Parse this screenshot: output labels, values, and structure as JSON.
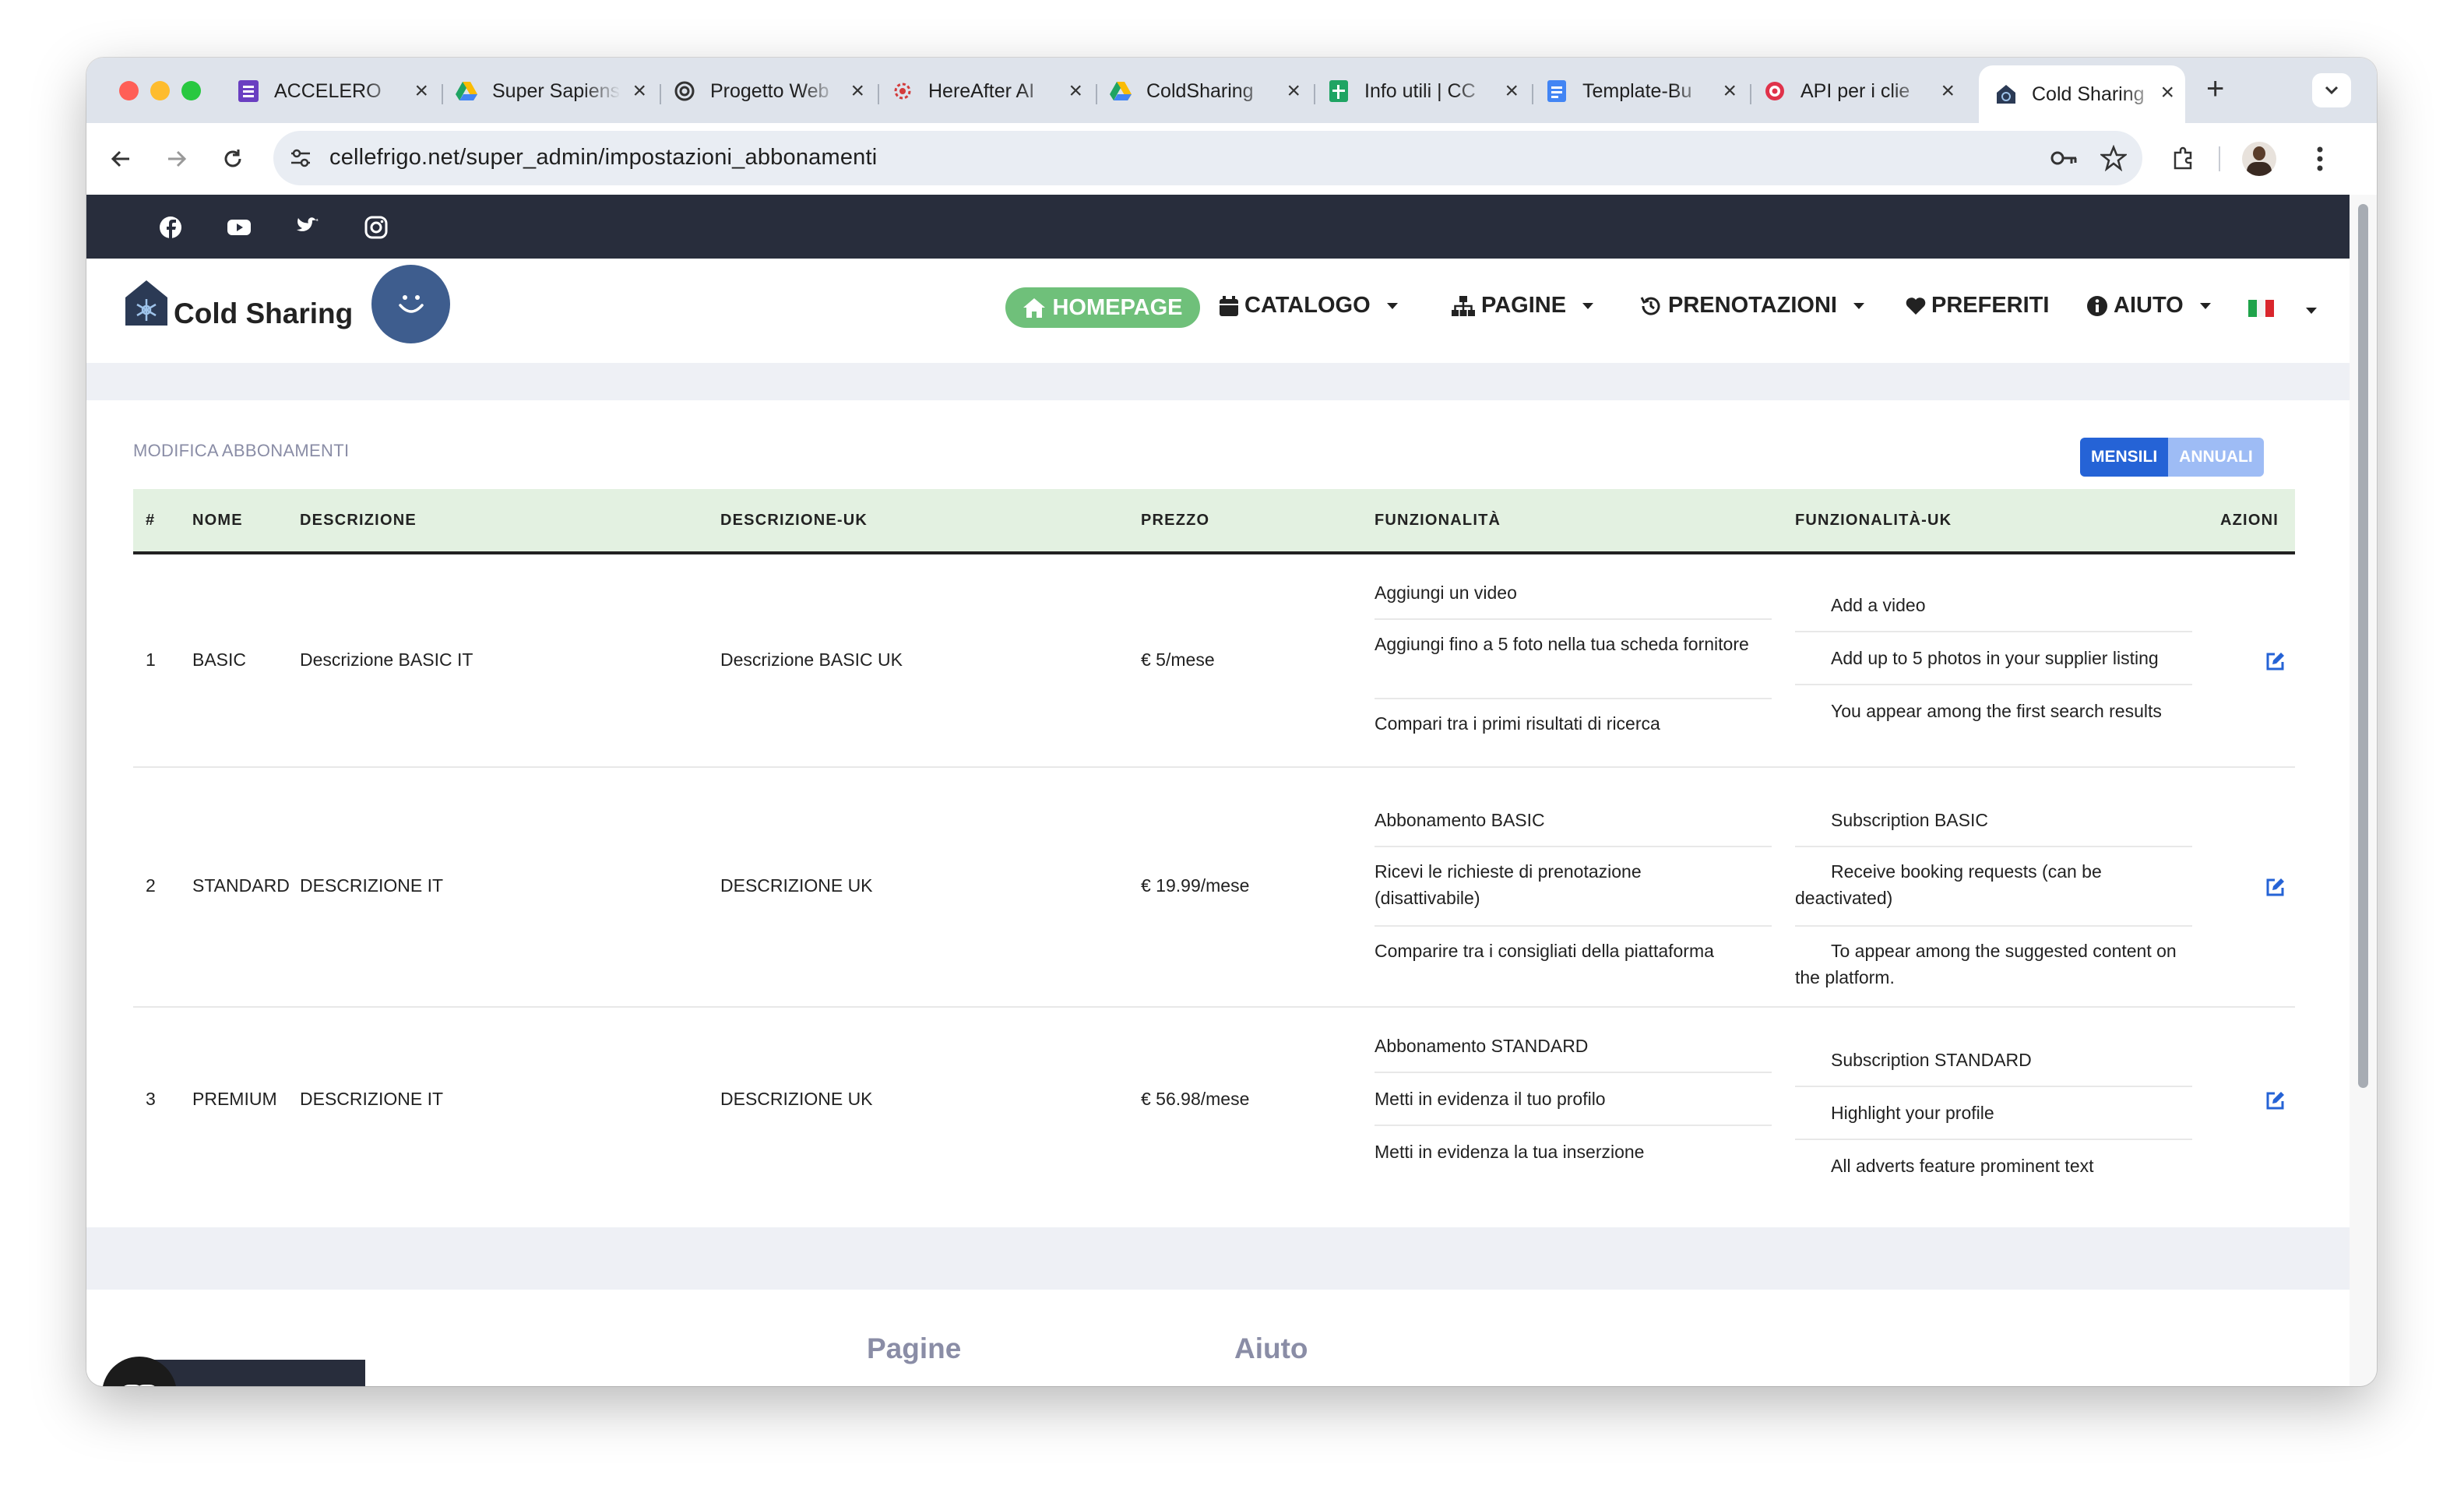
{
  "browser": {
    "tabs": [
      {
        "title": "ACCELERO",
        "icon": "forms-icon"
      },
      {
        "title": "Super Sapiens",
        "icon": "google-drive-icon"
      },
      {
        "title": "Progetto Web",
        "icon": "chatgpt-icon"
      },
      {
        "title": "HereAfter AI",
        "icon": "gear-icon"
      },
      {
        "title": "ColdSharing",
        "icon": "google-drive-icon"
      },
      {
        "title": "Info utili | CC",
        "icon": "sheets-icon"
      },
      {
        "title": "Template-Bu",
        "icon": "docs-icon"
      },
      {
        "title": "API per i clie",
        "icon": "target-icon"
      },
      {
        "title": "Cold Sharing",
        "icon": "site-icon",
        "active": true
      }
    ],
    "url": "cellefrigo.net/super_admin/impostazioni_abbonamenti"
  },
  "site": {
    "brand": "Cold Sharing",
    "social": [
      "facebook-icon",
      "youtube-icon",
      "twitter-icon",
      "instagram-icon"
    ],
    "nav": {
      "home": "HOMEPAGE",
      "catalogo": "CATALOGO",
      "pagine": "PAGINE",
      "prenotazioni": "PRENOTAZIONI",
      "preferiti": "PREFERITI",
      "aiuto": "AIUTO"
    }
  },
  "subs": {
    "title": "MODIFICA ABBONAMENTI",
    "toggle": {
      "monthly": "MENSILI",
      "annual": "ANNUALI"
    },
    "headers": {
      "num": "#",
      "name": "NOME",
      "desc": "DESCRIZIONE",
      "desc_uk": "DESCRIZIONE-UK",
      "price": "PREZZO",
      "feat": "FUNZIONALITÀ",
      "feat_uk": "FUNZIONALITÀ-UK",
      "actions": "AZIONI"
    },
    "rows": [
      {
        "num": "1",
        "name": "BASIC",
        "desc": "Descrizione BASIC IT",
        "desc_uk": "Descrizione BASIC UK",
        "price": "€ 5/mese",
        "feat": [
          "Aggiungi un video",
          "Aggiungi fino a 5 foto nella tua scheda fornitore",
          "Compari tra i primi risultati di ricerca"
        ],
        "feat_uk": [
          "Add a video",
          "Add up to 5 photos in your supplier listing",
          "You appear among the first search results"
        ]
      },
      {
        "num": "2",
        "name": "STANDARD",
        "desc": "DESCRIZIONE IT",
        "desc_uk": "DESCRIZIONE UK",
        "price": "€ 19.99/mese",
        "feat": [
          "Abbonamento BASIC",
          "Ricevi le richieste di prenotazione (disattivabile)",
          "Comparire tra i consigliati della piattaforma"
        ],
        "feat_uk": [
          "Subscription BASIC",
          "Receive booking requests (can be deactivated)",
          "To appear among the suggested content on the platform."
        ]
      },
      {
        "num": "3",
        "name": "PREMIUM",
        "desc": "DESCRIZIONE IT",
        "desc_uk": "DESCRIZIONE UK",
        "price": "€ 56.98/mese",
        "feat": [
          "Abbonamento STANDARD",
          "Metti in evidenza il tuo profilo",
          "Metti in evidenza la tua inserzione"
        ],
        "feat_uk": [
          "Subscription STANDARD",
          "Highlight your profile",
          "All adverts feature prominent text"
        ]
      }
    ]
  },
  "footer": {
    "col1": "Pagine",
    "col2": "Aiuto"
  },
  "colors": {
    "accent_green": "#6fc07a",
    "header_dark": "#282d3c",
    "toggle_active": "#2563d6",
    "toggle_inactive": "#9ebcf5",
    "table_header": "#e3f1e1"
  }
}
